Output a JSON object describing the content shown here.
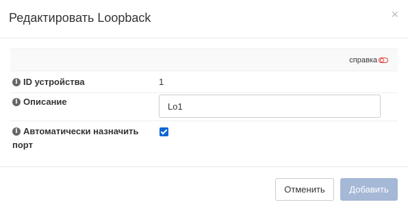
{
  "modal": {
    "title": "Редактировать Loopback",
    "close_glyph": "×"
  },
  "form": {
    "help_label": "справка",
    "device_id_label": "ID устройства",
    "device_id_value": "1",
    "description_label": "Описание",
    "description_value": "Lo1",
    "auto_port_label": "Автоматически назначить",
    "auto_port_label_line2": "порт",
    "auto_port_checked": true
  },
  "footer": {
    "cancel_label": "Отменить",
    "add_label": "Добавить"
  },
  "colors": {
    "accent": "#0a66d6",
    "add_button_disabled": "#a5b8d6",
    "help_toggle": "#e53935"
  },
  "icons": {
    "info": "info-circle-icon",
    "help_toggle": "toggle-off-icon",
    "close": "close-icon"
  }
}
